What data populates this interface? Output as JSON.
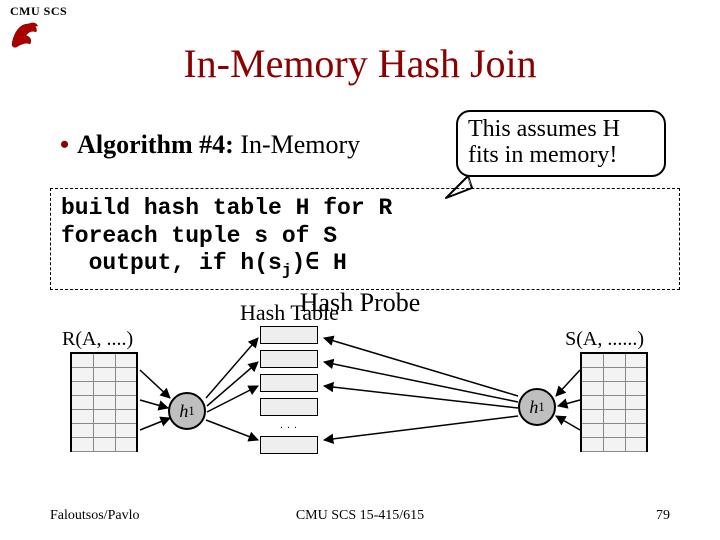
{
  "header": {
    "org": "CMU SCS"
  },
  "title": "In-Memory Hash Join",
  "bullet": {
    "label_bold": "Algorithm #4:",
    "label_rest": " In-Memory"
  },
  "callout": {
    "line1": "This assumes H",
    "line2": "fits in memory!"
  },
  "code": {
    "line1": "build hash table H for R",
    "line2": "foreach tuple s of S",
    "line3a": "  output, if h(s",
    "line3_sub": "j",
    "line3b": ")∈ H"
  },
  "diagram": {
    "hash_probe": "Hash Probe",
    "hash_table": "Hash Table",
    "r_label": "R(A, ....)",
    "s_label": "S(A, ......)",
    "h1": "h",
    "h1_sub": "1",
    "stack_dots": ". . ."
  },
  "footer": {
    "left": "Faloutsos/Pavlo",
    "center": "CMU SCS 15-415/615",
    "right": "79"
  }
}
